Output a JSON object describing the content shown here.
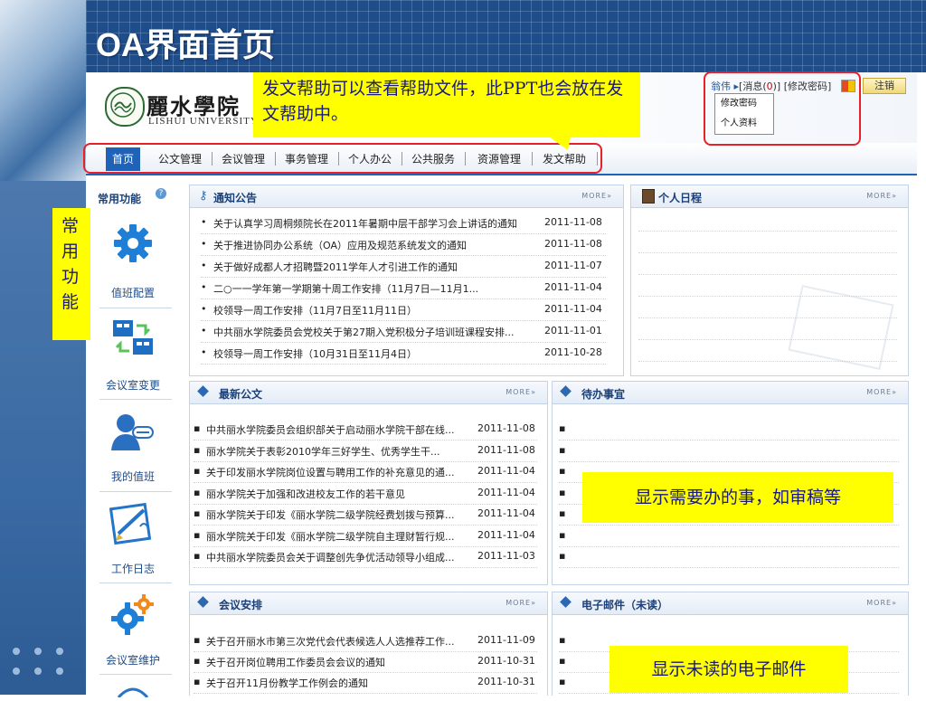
{
  "slide_title": "OA界面首页",
  "header": {
    "logo_cn": "麗水學院",
    "logo_en": "LISHUI UNIVERSITY",
    "user_name": "翁伟",
    "messages_label": "[消息(",
    "messages_count": "0",
    "messages_close": ")]",
    "change_password": "[修改密码]",
    "logout": "注销",
    "dropdown": [
      "修改密码",
      "个人资料"
    ]
  },
  "nav": {
    "home": "首页",
    "items": [
      "公文管理",
      "会议管理",
      "事务管理",
      "个人办公",
      "公共服务",
      "资源管理",
      "发文帮助"
    ]
  },
  "sidebar": {
    "title": "常用功能",
    "help": "?",
    "items": [
      "值班配置",
      "会议室变更",
      "我的值班",
      "工作日志",
      "会议室维护"
    ]
  },
  "panels": {
    "more": "MORE»",
    "notice": {
      "title": "通知公告",
      "rows": [
        {
          "title": "关于认真学习周桐频院长在2011年暑期中层干部学习会上讲话的通知",
          "date": "2011-11-08"
        },
        {
          "title": "关于推进协同办公系统（OA）应用及规范系统发文的通知",
          "date": "2011-11-08"
        },
        {
          "title": "关于做好成都人才招聘暨2011学年人才引进工作的通知",
          "date": "2011-11-07"
        },
        {
          "title": "二○一一学年第一学期第十周工作安排（11月7日—11月1...",
          "date": "2011-11-04"
        },
        {
          "title": "校领导一周工作安排（11月7日至11月11日）",
          "date": "2011-11-04"
        },
        {
          "title": "中共丽水学院委员会党校关于第27期入党积极分子培训班课程安排...",
          "date": "2011-11-01"
        },
        {
          "title": "校领导一周工作安排（10月31日至11月4日）",
          "date": "2011-10-28"
        }
      ]
    },
    "schedule": {
      "title": "个人日程"
    },
    "documents": {
      "title": "最新公文",
      "rows": [
        {
          "title": "中共丽水学院委员会组织部关于启动丽水学院干部在线...",
          "date": "2011-11-08"
        },
        {
          "title": "丽水学院关于表彰2010学年三好学生、优秀学生干...",
          "date": "2011-11-08"
        },
        {
          "title": "关于印发丽水学院岗位设置与聘用工作的补充意见的通...",
          "date": "2011-11-04"
        },
        {
          "title": "丽水学院关于加强和改进校友工作的若干意见",
          "date": "2011-11-04"
        },
        {
          "title": "丽水学院关于印发《丽水学院二级学院经费划拨与预算...",
          "date": "2011-11-04"
        },
        {
          "title": "丽水学院关于印发《丽水学院二级学院自主理财暂行规...",
          "date": "2011-11-04"
        },
        {
          "title": "中共丽水学院委员会关于调整创先争优活动领导小组成...",
          "date": "2011-11-03"
        }
      ]
    },
    "todo": {
      "title": "待办事宜"
    },
    "meetings": {
      "title": "会议安排",
      "rows": [
        {
          "title": "关于召开丽水市第三次党代会代表候选人人选推荐工作...",
          "date": "2011-11-09"
        },
        {
          "title": "关于召开岗位聘用工作委员会会议的通知",
          "date": "2011-10-31"
        },
        {
          "title": "关于召开11月份教学工作例会的通知",
          "date": "2011-10-31"
        }
      ]
    },
    "email": {
      "title": "电子邮件（未读）"
    }
  },
  "annotations": {
    "help_callout": "发文帮助可以查看帮助文件，此PPT也会放在发文帮助中。",
    "common_functions": "常用功能",
    "todo_callout": "显示需要办的事，如审稿等",
    "email_callout": "显示未读的电子邮件"
  },
  "colors": {
    "accent": "#1f63b8",
    "callout": "#ffff00",
    "highlight_border": "#e8202a"
  }
}
